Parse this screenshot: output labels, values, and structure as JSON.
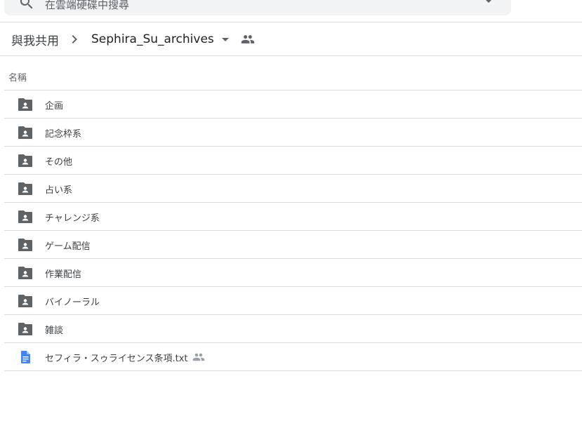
{
  "search": {
    "placeholder": "在雲端硬碟中搜尋",
    "search_icon": "search-icon",
    "options_icon": "tune-icon"
  },
  "breadcrumb": {
    "root": "與我共用",
    "current": "Sephira_Su_archives"
  },
  "table": {
    "column_name": "名稱",
    "rows": [
      {
        "name": "企画",
        "type": "shared-folder"
      },
      {
        "name": "記念枠系",
        "type": "shared-folder"
      },
      {
        "name": "その他",
        "type": "shared-folder"
      },
      {
        "name": "占い系",
        "type": "shared-folder"
      },
      {
        "name": "チャレンジ系",
        "type": "shared-folder"
      },
      {
        "name": "ゲーム配信",
        "type": "shared-folder"
      },
      {
        "name": "作業配信",
        "type": "shared-folder"
      },
      {
        "name": "バイノーラル",
        "type": "shared-folder"
      },
      {
        "name": "雑談",
        "type": "shared-folder"
      },
      {
        "name": "セフィラ・スゥライセンス条項.txt",
        "type": "doc",
        "shared": true
      }
    ]
  },
  "colors": {
    "folder": "#5f6368",
    "doc": "#4285f4",
    "divider": "#dadce0",
    "search_bg": "#f1f3f4"
  }
}
